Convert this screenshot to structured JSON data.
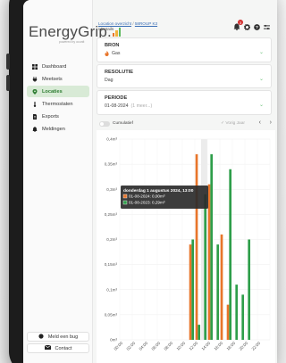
{
  "app": {
    "logo_text": "EnergyGrip.",
    "powered_by": "powered by ocunit"
  },
  "sidebar": {
    "items": [
      {
        "label": "Dashboard",
        "icon": "dashboard-icon"
      },
      {
        "label": "Meetsets",
        "icon": "plug-icon"
      },
      {
        "label": "Locaties",
        "icon": "location-pin-icon",
        "active": true
      },
      {
        "label": "Thermostaten",
        "icon": "thermometer-icon"
      },
      {
        "label": "Exports",
        "icon": "export-icon"
      },
      {
        "label": "Meldingen",
        "icon": "bell-icon"
      }
    ],
    "bug_button": "Meld een bug",
    "contact_button": "Contact"
  },
  "header": {
    "breadcrumb_1": "Location overzicht",
    "breadcrumb_2": "58ROUP K3",
    "subtitle": "/ Details",
    "notification_count": "3"
  },
  "filters": {
    "bron": {
      "title": "BRON",
      "value": "Gas",
      "icon": "flame-icon"
    },
    "resolutie": {
      "title": "RESOLUTIE",
      "value": "Dag"
    },
    "periode": {
      "title": "PERIODE",
      "value": "01-08-2024",
      "extra": "(1 meer...)"
    }
  },
  "controls": {
    "toggle_label": "Cumulatief",
    "previous_label": "Vorig Jaar"
  },
  "colors": {
    "series_2024": "#e8752a",
    "series_2023": "#2e9e4a",
    "accent": "#5cb85c",
    "logo_bars": [
      "#e8752a",
      "#f2b33d",
      "#5cb85c"
    ]
  },
  "tooltip": {
    "title": "donderdag 1 augustus 2024, 13:00",
    "line_1": "01-08-2024: 0,00m³",
    "line_2": "01-08-2023: 0,29m³"
  },
  "chart_data": {
    "type": "bar",
    "ylabel_unit": "m³",
    "ylim": [
      0,
      0.4
    ],
    "yticks": [
      "0m³",
      "0,05m³",
      "0,1m³",
      "0,15m³",
      "0,2m³",
      "0,25m³",
      "0,3m³",
      "0,35m³",
      "0,4m³"
    ],
    "categories": [
      "00:00",
      "01:00",
      "02:00",
      "03:00",
      "04:00",
      "05:00",
      "06:00",
      "07:00",
      "08:00",
      "09:00",
      "10:00",
      "11:00",
      "12:00",
      "13:00",
      "14:00",
      "15:00",
      "16:00",
      "17:00",
      "18:00",
      "19:00",
      "20:00",
      "21:00",
      "22:00",
      "23:00"
    ],
    "x_tick_labels": [
      "00:00",
      "02:00",
      "04:00",
      "06:00",
      "08:00",
      "10:00",
      "12:00",
      "14:00",
      "16:00",
      "18:00",
      "20:00",
      "22:00"
    ],
    "series": [
      {
        "name": "01-08-2024",
        "values": [
          0,
          0,
          0,
          0,
          0,
          0,
          0,
          0,
          0,
          0,
          0,
          0.19,
          0.37,
          0,
          0.31,
          0,
          0.21,
          0.07,
          0,
          0,
          0,
          0,
          0,
          0
        ]
      },
      {
        "name": "01-08-2023",
        "values": [
          0,
          0,
          0,
          0,
          0,
          0,
          0,
          0,
          0,
          0,
          0,
          0.2,
          0.03,
          0.29,
          0.37,
          0.19,
          0,
          0.34,
          0.11,
          0.09,
          0.2,
          0,
          0,
          0
        ]
      }
    ],
    "highlight_category": "13:00",
    "grid": true,
    "legend": "tooltip"
  }
}
